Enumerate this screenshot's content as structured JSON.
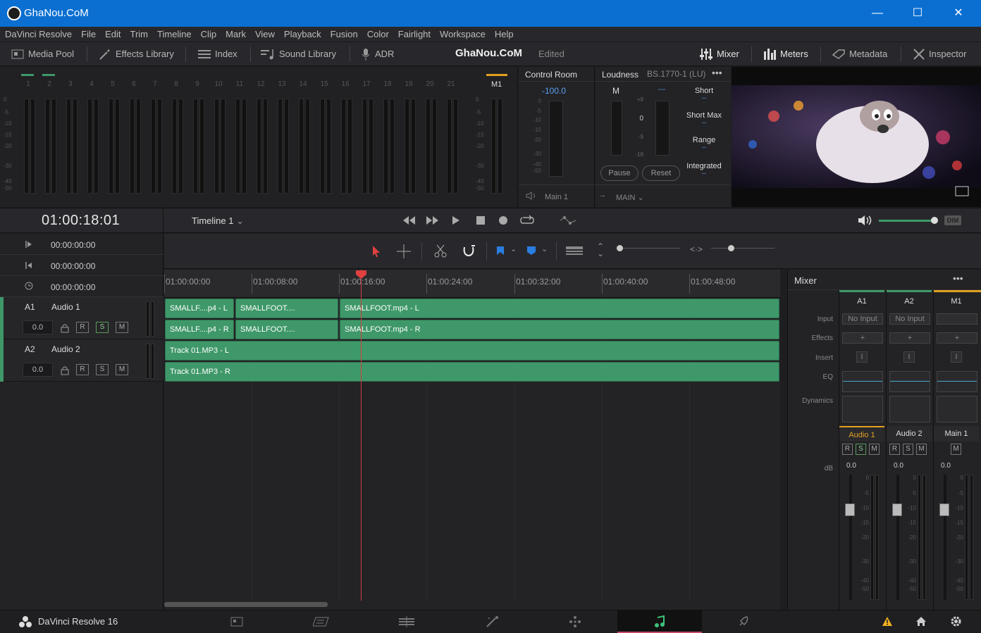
{
  "titlebar": {
    "title": "GhaNou.CoM",
    "minimize": "—",
    "maximize": "☐",
    "close": "✕"
  },
  "menu": [
    "DaVinci Resolve",
    "File",
    "Edit",
    "Trim",
    "Timeline",
    "Clip",
    "Mark",
    "View",
    "Playback",
    "Fusion",
    "Color",
    "Fairlight",
    "Workspace",
    "Help"
  ],
  "toolbar": {
    "media_pool": "Media Pool",
    "effects_library": "Effects Library",
    "index": "Index",
    "sound_library": "Sound Library",
    "adr": "ADR",
    "project_name": "GhaNou.CoM",
    "project_status": "Edited",
    "mixer": "Mixer",
    "meters": "Meters",
    "metadata": "Metadata",
    "inspector": "Inspector"
  },
  "meters": {
    "channels": [
      "1",
      "2",
      "3",
      "4",
      "5",
      "6",
      "7",
      "8",
      "9",
      "10",
      "11",
      "12",
      "13",
      "14",
      "15",
      "16",
      "17",
      "18",
      "19",
      "20",
      "21"
    ],
    "scale": [
      "0",
      "-5",
      "-10",
      "-15",
      "-20",
      "-30",
      "-40",
      "-50"
    ],
    "main_label": "M1"
  },
  "control_room": {
    "title": "Control Room",
    "value": "-100.0",
    "scale": [
      "0",
      "-5",
      "-10",
      "-15",
      "-20",
      "-30",
      "-40",
      "-50"
    ],
    "output": "Main 1",
    "route": "MAIN"
  },
  "loudness": {
    "title": "Loudness",
    "standard": "BS.1770-1 (LU)",
    "m_label": "M",
    "dashes": "---",
    "scale": [
      "+9",
      "0",
      "-9",
      "-18"
    ],
    "stats": [
      {
        "label": "Short",
        "value": "--"
      },
      {
        "label": "Short Max",
        "value": "--"
      },
      {
        "label": "Range",
        "value": "--"
      },
      {
        "label": "Integrated",
        "value": "--"
      }
    ],
    "pause": "Pause",
    "reset": "Reset"
  },
  "transport": {
    "timecode": "01:00:18:01",
    "timeline_name": "Timeline 1"
  },
  "timecodes": [
    "00:00:00:00",
    "00:00:00:00",
    "00:00:00:00"
  ],
  "tracks": [
    {
      "id": "A1",
      "name": "Audio 1",
      "volume": "0.0",
      "r": "R",
      "s": "S",
      "m": "M"
    },
    {
      "id": "A2",
      "name": "Audio 2",
      "volume": "0.0",
      "r": "R",
      "s": "S",
      "m": "M"
    }
  ],
  "ruler": [
    "01:00:00:00",
    "01:00:08:00",
    "01:00:16:00",
    "01:00:24:00",
    "01:00:32:00",
    "01:00:40:00",
    "01:00:48:00"
  ],
  "clips": {
    "a1_l": [
      "SMALLF....p4 - L",
      "SMALLFOOT....",
      "SMALLFOOT.mp4 - L"
    ],
    "a1_r": [
      "SMALLF....p4 - R",
      "SMALLFOOT....",
      "SMALLFOOT.mp4 - R"
    ],
    "a2_l": "Track 01.MP3 - L",
    "a2_r": "Track 01.MP3 - R"
  },
  "mixer": {
    "title": "Mixer",
    "columns": [
      "A1",
      "A2",
      "M1"
    ],
    "row_labels": [
      "Input",
      "Effects",
      "Insert",
      "EQ",
      "Dynamics"
    ],
    "inputs": [
      "No Input",
      "No Input",
      ""
    ],
    "effects_add": "+",
    "insert": "I",
    "names": [
      "Audio 1",
      "Audio 2",
      "Main 1"
    ],
    "db_label": "dB",
    "db_values": [
      "0.0",
      "0.0",
      "0.0"
    ],
    "fader_scale": [
      "0",
      "-5",
      "-10",
      "-15",
      "-20",
      "-30",
      "-40",
      "-50"
    ]
  },
  "bottom": {
    "app_name": "DaVinci Resolve 16"
  },
  "colors": {
    "accent": "#0a6fd1",
    "clip": "#3f9869",
    "playhead": "#e04040",
    "audio1": "#e0a020"
  }
}
